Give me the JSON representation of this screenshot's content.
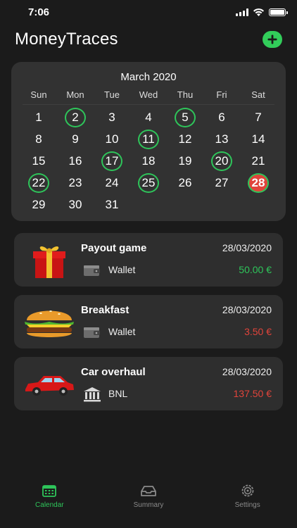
{
  "status_bar": {
    "time": "7:06"
  },
  "header": {
    "title": "MoneyTraces",
    "add_icon": "plus-icon",
    "accent": "#32cd5a"
  },
  "calendar": {
    "month_label": "March 2020",
    "weekdays": [
      "Sun",
      "Mon",
      "Tue",
      "Wed",
      "Thu",
      "Fri",
      "Sat"
    ],
    "weeks": [
      [
        "1",
        "2",
        "3",
        "4",
        "5",
        "6",
        "7"
      ],
      [
        "8",
        "9",
        "10",
        "11",
        "12",
        "13",
        "14"
      ],
      [
        "15",
        "16",
        "17",
        "18",
        "19",
        "20",
        "21"
      ],
      [
        "22",
        "23",
        "24",
        "25",
        "26",
        "27",
        "28"
      ],
      [
        "29",
        "30",
        "31",
        "",
        "",
        "",
        ""
      ]
    ],
    "marked_days": [
      "2",
      "5",
      "11",
      "17",
      "20",
      "22",
      "25"
    ],
    "today": "28",
    "marked_color": "#2ec55a",
    "today_color": "#e0443b"
  },
  "transactions": [
    {
      "title": "Payout game",
      "date": "28/03/2020",
      "account": "Wallet",
      "account_icon": "wallet-icon",
      "amount": "50.00 €",
      "kind": "income",
      "image": "gift-icon"
    },
    {
      "title": "Breakfast",
      "date": "28/03/2020",
      "account": "Wallet",
      "account_icon": "wallet-icon",
      "amount": "3.50 €",
      "kind": "expense",
      "image": "burger-icon"
    },
    {
      "title": "Car overhaul",
      "date": "28/03/2020",
      "account": "BNL",
      "account_icon": "bank-icon",
      "amount": "137.50 €",
      "kind": "expense",
      "image": "car-icon"
    }
  ],
  "tabbar": {
    "tabs": [
      {
        "label": "Calendar",
        "icon": "calendar-icon",
        "active": true
      },
      {
        "label": "Summary",
        "icon": "tray-icon",
        "active": false
      },
      {
        "label": "Settings",
        "icon": "gear-icon",
        "active": false
      }
    ]
  }
}
